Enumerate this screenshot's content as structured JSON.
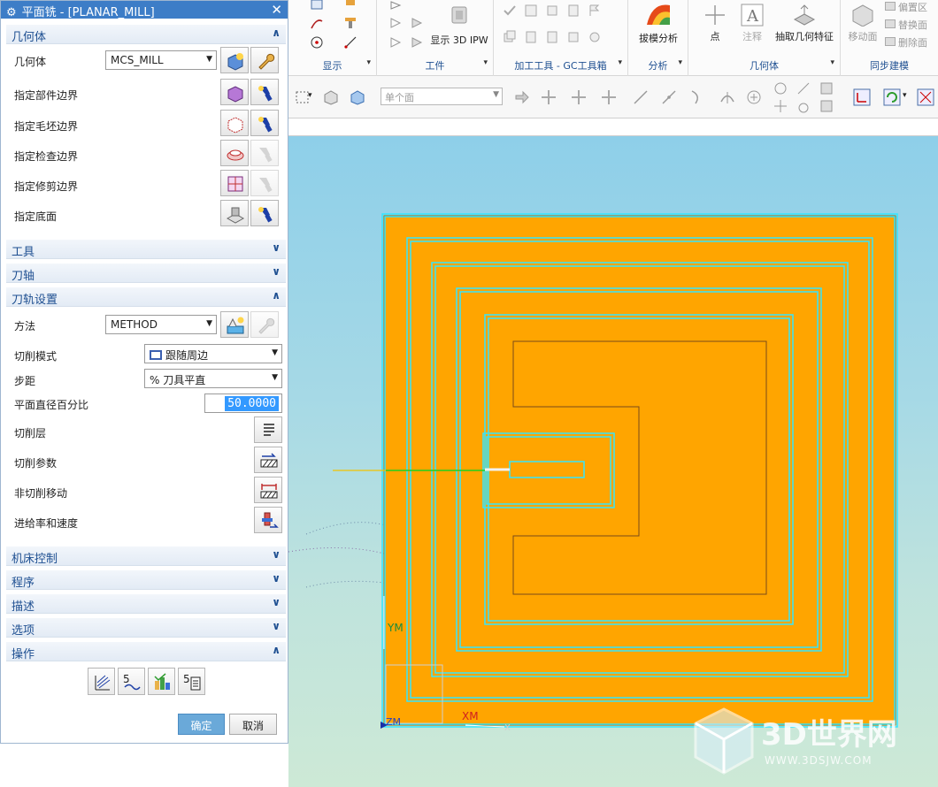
{
  "dialog": {
    "title": "平面铣 - [PLANAR_MILL]",
    "sections": {
      "geometry": "几何体",
      "tool": "工具",
      "axis": "刀轴",
      "path_settings": "刀轨设置",
      "machine_control": "机床控制",
      "program": "程序",
      "description": "描述",
      "options": "选项",
      "actions": "操作"
    },
    "geometry": {
      "geometry_label": "几何体",
      "geometry_value": "MCS_MILL",
      "rows": [
        "指定部件边界",
        "指定毛坯边界",
        "指定检查边界",
        "指定修剪边界",
        "指定底面"
      ]
    },
    "path_settings": {
      "method_label": "方法",
      "method_value": "METHOD",
      "cut_pattern_label": "切削模式",
      "cut_pattern_value": "跟随周边",
      "stepover_label": "步距",
      "stepover_value": "% 刀具平直",
      "percent_label": "平面直径百分比",
      "percent_value": "50.0000",
      "rows": [
        "切削层",
        "切削参数",
        "非切削移动",
        "进给率和速度"
      ]
    },
    "ok": "确定",
    "cancel": "取消"
  },
  "ribbon": {
    "show_3d_ipw": "显示 3D IPW",
    "groups": [
      "显示",
      "工件",
      "加工工具 - GC工具箱",
      "分析",
      "几何体",
      "同步建模"
    ],
    "drafting_analysis": "拔模分析",
    "point": "点",
    "annotation": "注释",
    "extract_geometry": "抽取几何特征",
    "move_face": "移动面",
    "offset_region": "偏置区",
    "replace_face": "替换面",
    "delete_face": "删除面"
  },
  "toolbar": {
    "filter_value": "单个面"
  },
  "viewport": {
    "labels": {
      "ym": "YM",
      "zm": "ZM",
      "xm": "XM",
      "x": "X"
    }
  },
  "watermark": {
    "brand": "3D世界网",
    "url": "WWW.3DSJW.COM"
  },
  "colors": {
    "title_bar": "#3d7dc7",
    "section_text": "#1e4f91",
    "part_fill": "#ffa500",
    "tool_path": "#33e6ff"
  }
}
